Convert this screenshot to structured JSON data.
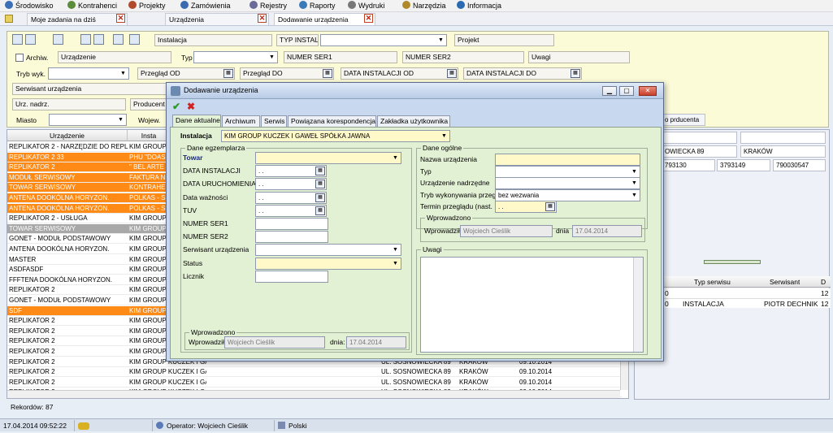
{
  "menu": [
    {
      "label": "Środowisko",
      "icon": "environment-icon",
      "color": "#3b6fb6"
    },
    {
      "label": "Kontrahenci",
      "icon": "contractors-icon",
      "color": "#5a8c3a"
    },
    {
      "label": "Projekty",
      "icon": "projects-icon",
      "color": "#b04a2a"
    },
    {
      "label": "Zamówienia",
      "icon": "orders-icon",
      "color": "#3a6ab0"
    },
    {
      "label": "Rejestry",
      "icon": "registers-icon",
      "color": "#6a6a9a"
    },
    {
      "label": "Raporty",
      "icon": "reports-icon",
      "color": "#3a7ab8"
    },
    {
      "label": "Wydruki",
      "icon": "printouts-icon",
      "color": "#777777"
    },
    {
      "label": "Narzędzia",
      "icon": "tools-icon",
      "color": "#b08a2a"
    },
    {
      "label": "Informacja",
      "icon": "info-icon",
      "color": "#2a6ab0"
    }
  ],
  "doc_tabs": [
    {
      "label": "Moje zadania na dziś",
      "active": false
    },
    {
      "label": "Urządzenia",
      "active": false
    },
    {
      "label": "Dodawanie urządzenia",
      "active": true
    }
  ],
  "filters": {
    "instalacja": "Instalacja",
    "typ_install": "TYP INSTALL",
    "projekt": "Projekt",
    "archiw": "Archiw.",
    "urzadzenie": "Urządzenie",
    "typ": "Typ",
    "numer_ser1": "NUMER SER1",
    "numer_ser2": "NUMER SER2",
    "uwagi": "Uwagi",
    "tryb_wyk": "Tryb wyk.",
    "przeglad_od": "Przegląd OD",
    "przeglad_do": "Przegląd DO",
    "data_inst_od": "DATA INSTALACJI OD",
    "data_inst_do": "DATA INSTALACJI DO",
    "date_placeholder": ". .",
    "serwisant": "Serwisant urządzenia",
    "urz_nadrz": "Urz. nadrz.",
    "producent": "Producent",
    "miasto": "Miasto",
    "wojew": "Wojew."
  },
  "grid": {
    "headers": [
      "Urządzenie",
      "Insta"
    ],
    "rows": [
      {
        "c": [
          "REPLIKATOR 2 - NARZĘDZIE DO REPLIK",
          "KIM GROUP",
          "",
          "",
          "",
          ""
        ],
        "style": "normal"
      },
      {
        "c": [
          "REPLIKATOR 2 33",
          "PHU \"DOASD",
          "",
          "",
          "",
          ""
        ],
        "style": "orange"
      },
      {
        "c": [
          "REPLIKATOR 2",
          "\" BEL ARTE",
          "",
          "",
          "",
          ""
        ],
        "style": "orange"
      },
      {
        "c": [
          "MODUŁ SERWISOWY",
          "FAKTURA N",
          "",
          "",
          "",
          ""
        ],
        "style": "orange"
      },
      {
        "c": [
          "TOWAR SERWISOWY",
          "KONTRAHEN",
          "",
          "",
          "",
          ""
        ],
        "style": "orange"
      },
      {
        "c": [
          "ANTENA DOOKÓLNA HORYZON.",
          "POLKAS - S",
          "",
          "",
          "",
          ""
        ],
        "style": "orange"
      },
      {
        "c": [
          "ANTENA DOOKÓLNA HORYZON.",
          "POLKAS - S",
          "",
          "",
          "",
          ""
        ],
        "style": "orange"
      },
      {
        "c": [
          "REPLIKATOR 2 - USŁUGA",
          "KIM GROUP",
          "",
          "",
          "",
          ""
        ],
        "style": "normal"
      },
      {
        "c": [
          "TOWAR SERWISOWY",
          "KIM GROUP",
          "",
          "",
          "",
          ""
        ],
        "style": "gray"
      },
      {
        "c": [
          "GONET - MODUŁ PODSTAWOWY",
          "KIM GROUP",
          "",
          "",
          "",
          ""
        ],
        "style": "normal"
      },
      {
        "c": [
          "ANTENA DOOKÓLNA HORYZON.",
          "KIM GROUP",
          "",
          "",
          "",
          ""
        ],
        "style": "normal"
      },
      {
        "c": [
          "MASTER",
          "KIM GROUP",
          "",
          "",
          "",
          ""
        ],
        "style": "normal"
      },
      {
        "c": [
          "ASDFASDF",
          "KIM GROUP",
          "",
          "",
          "",
          ""
        ],
        "style": "normal"
      },
      {
        "c": [
          "FFFTENA DOOKÓLNA HORYZON.",
          "KIM GROUP",
          "",
          "",
          "",
          ""
        ],
        "style": "normal"
      },
      {
        "c": [
          "REPLIKATOR 2",
          "KIM GROUP",
          "",
          "",
          "",
          ""
        ],
        "style": "normal"
      },
      {
        "c": [
          "GONET - MODUŁ PODSTAWOWY",
          "KIM GROUP",
          "",
          "",
          "",
          ""
        ],
        "style": "normal"
      },
      {
        "c": [
          "SDF",
          "KIM GROUP",
          "",
          "",
          "",
          ""
        ],
        "style": "orange"
      },
      {
        "c": [
          "REPLIKATOR 2",
          "KIM GROUP",
          "",
          "",
          "",
          ""
        ],
        "style": "normal"
      },
      {
        "c": [
          "REPLIKATOR 2",
          "KIM GROUP",
          "",
          "",
          "",
          ""
        ],
        "style": "normal"
      },
      {
        "c": [
          "REPLIKATOR 2",
          "KIM GROUP",
          "",
          "",
          "",
          ""
        ],
        "style": "normal"
      },
      {
        "c": [
          "REPLIKATOR 2",
          "KIM GROUP",
          "",
          "",
          "",
          ""
        ],
        "style": "normal"
      },
      {
        "c": [
          "REPLIKATOR 2",
          "KIM GROUP KUCZEK I GAV",
          "",
          "UL. SOSNOWIECKA 89",
          "KRAKÓW",
          "09.10.2014"
        ],
        "style": "normal"
      },
      {
        "c": [
          "REPLIKATOR 2",
          "KIM GROUP KUCZEK I GAV",
          "",
          "UL. SOSNOWIECKA 89",
          "KRAKÓW",
          "09.10.2014"
        ],
        "style": "normal"
      },
      {
        "c": [
          "REPLIKATOR 2",
          "KIM GROUP KUCZEK I GAV",
          "",
          "UL. SOSNOWIECKA 89",
          "KRAKÓW",
          "09.10.2014"
        ],
        "style": "normal"
      },
      {
        "c": [
          "REPLIKATOR 2",
          "KIM GROUP KUCZEK I GAV",
          "",
          "UL. SOSNOWIECKA 89",
          "KRAKÓW",
          "09.10.2014"
        ],
        "style": "normal"
      }
    ],
    "record_count": "Rekordów: 87"
  },
  "right_pane": {
    "tab_label": "o prducenta",
    "address_cells": [
      "OWIECKA 89",
      "KRAKÓW"
    ],
    "phone_cells": [
      "793130",
      "3793149",
      "790030547"
    ],
    "table_headers": [
      "Typ serwisu",
      "Serwisant",
      "D"
    ],
    "table_row": [
      "0",
      "INSTALACJA",
      "PIOTR DECHNIK",
      "12"
    ],
    "table_row_top": [
      "0",
      "12"
    ]
  },
  "dialog": {
    "title": "Dodawanie urządzenia",
    "tabs": [
      "Dane aktualne",
      "Archiwum",
      "Serwis",
      "Powiązana korespondencja",
      "Zakładka użytkownika"
    ],
    "instalacja_label": "Instalacja",
    "instalacja_value": "KIM GROUP KUCZEK I GAWEŁ SPÓŁKA JAWNA",
    "left_group": {
      "title": "Dane egzemplarza",
      "fields": [
        {
          "label": "Towar",
          "kind": "combo",
          "value": ""
        },
        {
          "label": "DATA INSTALACJI",
          "kind": "date",
          "value": ". ."
        },
        {
          "label": "DATA URUCHOMIENIA",
          "kind": "date",
          "value": ". ."
        },
        {
          "label": "Data ważności",
          "kind": "date",
          "value": ". ."
        },
        {
          "label": "TUV",
          "kind": "date",
          "value": ". ."
        },
        {
          "label": "NUMER SER1",
          "kind": "text",
          "value": ""
        },
        {
          "label": "NUMER SER2",
          "kind": "text",
          "value": ""
        },
        {
          "label": "Serwisant urządzenia",
          "kind": "combo",
          "value": ""
        },
        {
          "label": "Status",
          "kind": "combo",
          "value": ""
        },
        {
          "label": "Licznik",
          "kind": "text",
          "value": ""
        }
      ],
      "wprowadzono_title": "Wprowadzono",
      "wprowadzil_label": "Wprowadził",
      "wprowadzil_value": "Wojciech Cieślik",
      "dnia_label": "dnia:",
      "dnia_value": "17.04.2014"
    },
    "right_group": {
      "title": "Dane ogólne",
      "fields": [
        {
          "label": "Nazwa urządzenia",
          "kind": "text",
          "value": ""
        },
        {
          "label": "Typ",
          "kind": "combo",
          "value": ""
        },
        {
          "label": "Urządzenie nadrzędne",
          "kind": "combo",
          "value": ""
        },
        {
          "label": "Tryb wykonywania przeglądu",
          "kind": "combo",
          "value": "bez wezwania"
        },
        {
          "label": "Termin przeglądu (nast.",
          "kind": "date",
          "value": ". ."
        }
      ],
      "wprowadzono_title": "Wprowadzono",
      "wprowadzil_label": "Wprowadził",
      "wprowadzil_value": "Wojciech Cieślik",
      "dnia_label": "dnia",
      "dnia_value": "17.04.2014",
      "uwagi_title": "Uwagi"
    }
  },
  "status": {
    "datetime": "17.04.2014 09:52:22",
    "operator": "Operator: Wojciech Cieślik",
    "language": "Polski"
  },
  "colors": {
    "orange": "#ff8a15",
    "selected_gray": "#a8a8a8",
    "filter_bg": "#fcfbd8",
    "dialog_body": "#e2f0d4"
  }
}
